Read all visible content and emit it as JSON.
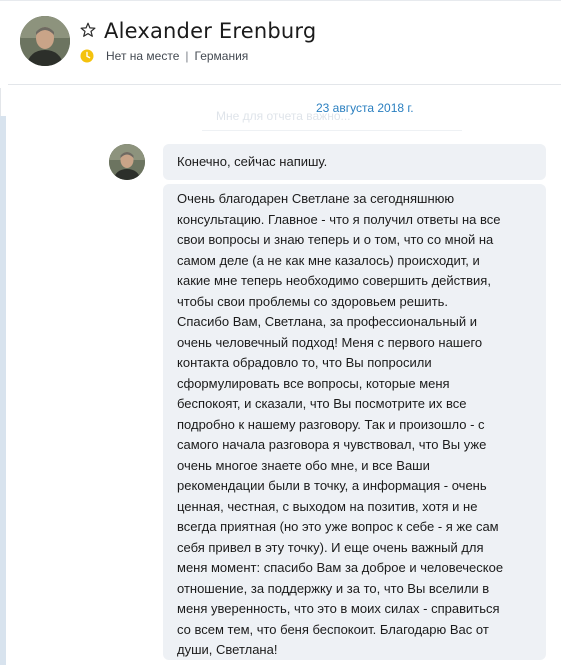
{
  "header": {
    "contact_name": "Alexander Erenburg",
    "status": "Нет на месте",
    "separator": "|",
    "country": "Германия",
    "favorite_icon": "star-outline-icon",
    "status_icon": "away-clock-icon",
    "status_color": "#f4c20d"
  },
  "conversation": {
    "ghost_text": "Мне для отчета важно...",
    "date": "23 августа 2018 г.",
    "messages": [
      {
        "text": "Конечно, сейчас напишу."
      },
      {
        "lines": [
          "Очень благодарен Светлане за сегодняшнюю",
          "консультацию. Главное - что я получил ответы на все",
          "свои вопросы и знаю теперь и о том, что со мной на",
          "самом деле (а не как мне казалось) происходит, и",
          "какие мне теперь необходимо совершить действия,",
          "чтобы свои проблемы со здоровьем решить.",
          "Спасибо Вам, Светлана, за профессиональный и",
          "очень человечный подход!  Меня с первого нашего",
          "контакта обрадовло то, что Вы попросили",
          "сформулировать все вопросы, которые меня",
          "беспокоят, и сказали, что Вы посмотрите их все",
          "подробно к нашему разговору. Так и произошло - с",
          "самого начала разговора я чувствовал, что Вы уже",
          "очень многое знаете обо мне, и все Ваши",
          "рекомендации были в точку, а информация - очень",
          "ценная, честная, с выходом на позитив, хотя и не",
          "всегда приятная (но это уже вопрос к себе - я же сам",
          "себя привел в эту точку). И еще очень важный для",
          "меня момент: спасибо Вам за доброе и человеческое",
          "отношение, за поддержку и за то, что Вы вселили в",
          "меня уверенность, что это в моих силах - справиться",
          "со всем тем, что беня беспокоит. Благодарю Вас от",
          "души, Светлана!"
        ]
      }
    ]
  }
}
